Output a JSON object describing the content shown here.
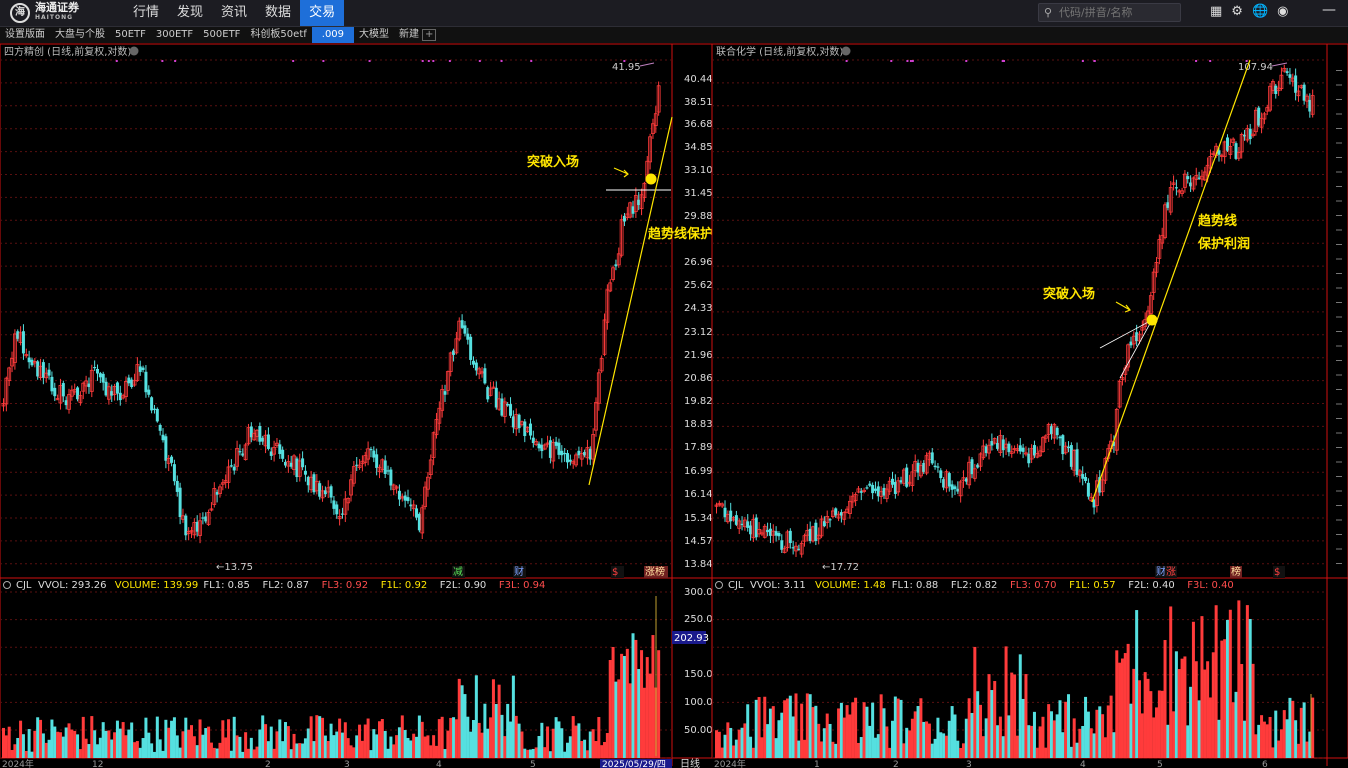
{
  "topbar": {
    "logo_cn": "海通证券",
    "logo_en": "HAITONG",
    "nav": [
      "行情",
      "发现",
      "资讯",
      "数据",
      "交易"
    ],
    "active_nav": 4,
    "search_placeholder": "代码/拼音/名称"
  },
  "toolbar": {
    "items": [
      "设置版面",
      "大盘与个股",
      "50ETF",
      "300ETF",
      "500ETF",
      "科创板50etf",
      ".009",
      "大模型",
      "新建"
    ],
    "selected": 6
  },
  "colors": {
    "up": "#ff3b3b",
    "down": "#55e0e0",
    "grid": "#5a1010",
    "axis": "#d01010",
    "annotation": "#ffe600",
    "title": "#bbbbbb"
  },
  "left_chart": {
    "title": "四方精创 (日线,前复权,对数)",
    "high_label": "41.95",
    "low_label": "←13.75",
    "annotation_1": "突破入场",
    "annotation_2": "趋势线保护利润",
    "price_axis": [
      "40.44",
      "38.51",
      "36.68",
      "34.85",
      "33.10",
      "31.45",
      "29.88",
      "26.96",
      "25.62",
      "24.33",
      "23.12",
      "21.96",
      "20.86",
      "19.82",
      "18.83",
      "17.89",
      "16.99",
      "16.14",
      "15.34",
      "14.57",
      "13.84"
    ],
    "event_labels": [
      "减",
      "财",
      "$",
      "涨榜"
    ],
    "indicator": {
      "prefix": "CJL",
      "items": [
        {
          "label": "VVOL: 293.26",
          "color": "#dddddd"
        },
        {
          "label": "VOLUME: 139.99",
          "color": "#ffe600"
        },
        {
          "label": "FL1: 0.85",
          "color": "#dddddd"
        },
        {
          "label": "FL2: 0.87",
          "color": "#dddddd"
        },
        {
          "label": "FL3: 0.92",
          "color": "#ff4d4d"
        },
        {
          "label": "F1L: 0.92",
          "color": "#ffe600"
        },
        {
          "label": "F2L: 0.90",
          "color": "#dddddd"
        },
        {
          "label": "F3L: 0.94",
          "color": "#ff4d4d"
        }
      ]
    },
    "volume_axis": [
      "300.0",
      "250.0",
      "202.93",
      "150.0",
      "100.0",
      "50.00"
    ],
    "volume_marker": "202.93",
    "date_axis": [
      "2024年",
      "12",
      "2",
      "3",
      "4",
      "5"
    ],
    "date_highlight": "2025/05/29/四",
    "period_label": "日线"
  },
  "right_chart": {
    "title": "联合化学 (日线,前复权,对数)",
    "high_label": "107.94",
    "low_label": "←17.72",
    "annotation_1": "突破入场",
    "annotation_2a": "趋势线",
    "annotation_2b": "保护利润",
    "event_labels": [
      "财",
      "涨",
      "榜",
      "$"
    ],
    "indicator": {
      "prefix": "CJL",
      "items": [
        {
          "label": "VVOL: 3.11",
          "color": "#dddddd"
        },
        {
          "label": "VOLUME: 1.48",
          "color": "#ffe600"
        },
        {
          "label": "FL1: 0.88",
          "color": "#dddddd"
        },
        {
          "label": "FL2: 0.82",
          "color": "#dddddd"
        },
        {
          "label": "FL3: 0.70",
          "color": "#ff4d4d"
        },
        {
          "label": "F1L: 0.57",
          "color": "#ffe600"
        },
        {
          "label": "F2L: 0.40",
          "color": "#dddddd"
        },
        {
          "label": "F3L: 0.40",
          "color": "#ff4d4d"
        }
      ]
    },
    "date_axis": [
      "2024年",
      "1",
      "2",
      "3",
      "4",
      "5",
      "6"
    ]
  },
  "chart_data": [
    {
      "type": "candlestick",
      "title": "四方精创 (日线,前复权,对数)",
      "series": [
        {
          "name": "price",
          "start": 22.0,
          "end": 41.95,
          "low": 13.75,
          "high": 41.95
        }
      ],
      "ylim": [
        13.84,
        40.44
      ],
      "yscale": "log",
      "breakout_price": 31.45,
      "volume_ylim": [
        0,
        300
      ],
      "volume_last": 202.93
    },
    {
      "type": "candlestick",
      "title": "联合化学 (日线,前复权,对数)",
      "series": [
        {
          "name": "price",
          "start": 21.0,
          "end": 95.0,
          "low": 17.72,
          "high": 107.94
        }
      ],
      "yscale": "log"
    }
  ]
}
